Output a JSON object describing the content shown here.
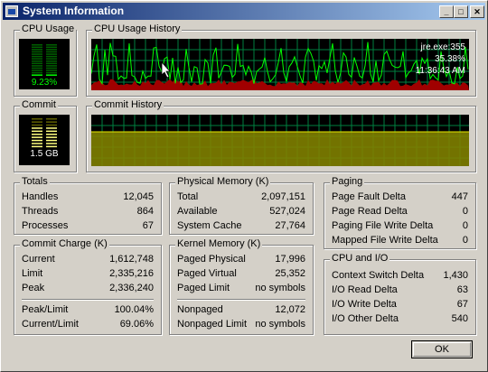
{
  "window": {
    "title": "System Information",
    "minimize": "_",
    "maximize": "□",
    "close": "✕"
  },
  "cpu_usage": {
    "label": "CPU Usage",
    "value": "9.23%",
    "level": 0.0923
  },
  "cpu_history": {
    "label": "CPU Usage History",
    "process": "jre.exe:355",
    "percent": "35.38%",
    "time": "11:36:43 AM"
  },
  "commit": {
    "label": "Commit",
    "value": "1.5 GB",
    "level": 0.6906
  },
  "commit_history": {
    "label": "Commit History"
  },
  "totals": {
    "label": "Totals",
    "rows": [
      {
        "k": "Handles",
        "v": "12,045"
      },
      {
        "k": "Threads",
        "v": "864"
      },
      {
        "k": "Processes",
        "v": "67"
      }
    ]
  },
  "physical_memory": {
    "label": "Physical Memory (K)",
    "rows": [
      {
        "k": "Total",
        "v": "2,097,151"
      },
      {
        "k": "Available",
        "v": "527,024"
      },
      {
        "k": "System Cache",
        "v": "27,764"
      }
    ]
  },
  "paging": {
    "label": "Paging",
    "rows": [
      {
        "k": "Page Fault Delta",
        "v": "447"
      },
      {
        "k": "Page Read Delta",
        "v": "0"
      },
      {
        "k": "Paging File Write Delta",
        "v": "0"
      },
      {
        "k": "Mapped File Write Delta",
        "v": "0"
      }
    ]
  },
  "commit_charge": {
    "label": "Commit Charge (K)",
    "rows": [
      {
        "k": "Current",
        "v": "1,612,748"
      },
      {
        "k": "Limit",
        "v": "2,335,216"
      },
      {
        "k": "Peak",
        "v": "2,336,240"
      },
      {
        "k": "Peak/Limit",
        "v": "100.04%"
      },
      {
        "k": "Current/Limit",
        "v": "69.06%"
      }
    ]
  },
  "kernel_memory": {
    "label": "Kernel Memory (K)",
    "rows": [
      {
        "k": "Paged Physical",
        "v": "17,996"
      },
      {
        "k": "Paged Virtual",
        "v": "25,352"
      },
      {
        "k": "Paged Limit",
        "v": "no symbols"
      },
      {
        "k": "Nonpaged",
        "v": "12,072"
      },
      {
        "k": "Nonpaged Limit",
        "v": "no symbols"
      }
    ]
  },
  "cpu_io": {
    "label": "CPU and I/O",
    "rows": [
      {
        "k": "Context Switch Delta",
        "v": "1,430"
      },
      {
        "k": "I/O Read Delta",
        "v": "63"
      },
      {
        "k": "I/O Write Delta",
        "v": "67"
      },
      {
        "k": "I/O Other Delta",
        "v": "540"
      }
    ]
  },
  "ok_button": "OK",
  "colors": {
    "graph_green": "#00ff00",
    "graph_red": "#c00000",
    "grid": "#008040",
    "commit_fill": "#808000",
    "meter_bg": "#000000"
  }
}
